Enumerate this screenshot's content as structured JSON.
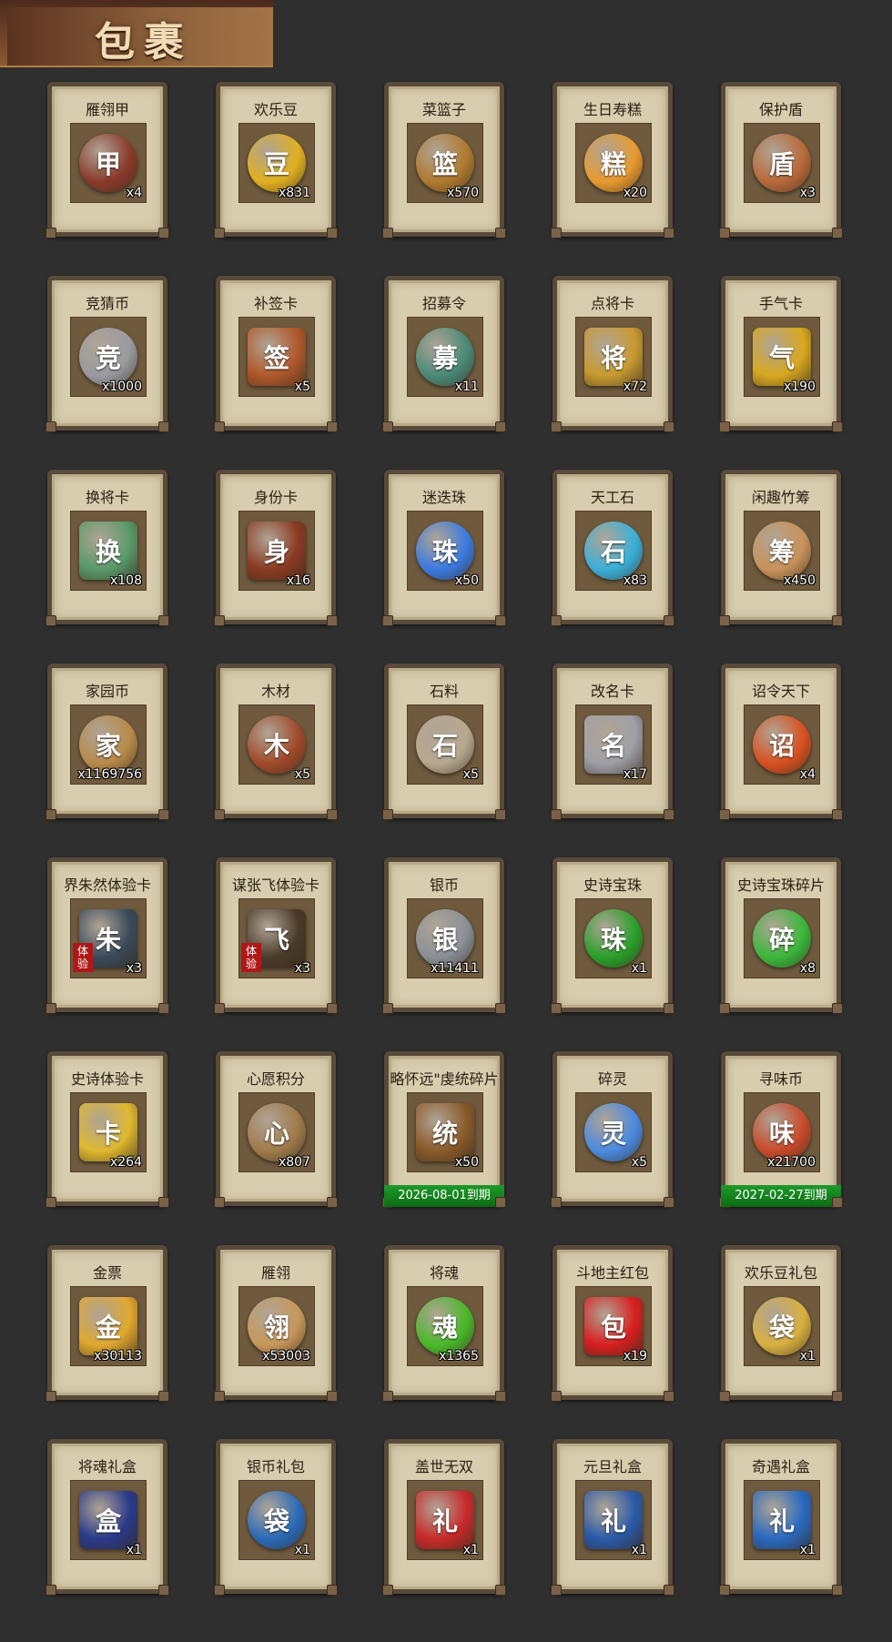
{
  "header": {
    "title": "包裹"
  },
  "items": [
    {
      "name": "雁翎甲",
      "count": "x4",
      "icon": "armor-icon",
      "color": "#8a3a2a",
      "glyph": "甲"
    },
    {
      "name": "欢乐豆",
      "count": "x831",
      "icon": "gold-beans-icon",
      "color": "#e0b020",
      "glyph": "豆"
    },
    {
      "name": "菜篮子",
      "count": "x570",
      "icon": "basket-icon",
      "color": "#b07a30",
      "glyph": "篮"
    },
    {
      "name": "生日寿糕",
      "count": "x20",
      "icon": "cake-icon",
      "color": "#e89a30",
      "glyph": "糕"
    },
    {
      "name": "保护盾",
      "count": "x3",
      "icon": "shield-icon",
      "color": "#b86a3a",
      "glyph": "盾"
    },
    {
      "name": "竞猜币",
      "count": "x1000",
      "icon": "silver-coin-icon",
      "color": "#9a9aa0",
      "glyph": "竞"
    },
    {
      "name": "补签卡",
      "count": "x5",
      "icon": "sign-card-icon",
      "color": "#b0582a",
      "glyph": "签"
    },
    {
      "name": "招募令",
      "count": "x11",
      "icon": "recruit-token-icon",
      "color": "#4a8a78",
      "glyph": "募"
    },
    {
      "name": "点将卡",
      "count": "x72",
      "icon": "general-card-icon",
      "color": "#c89a30",
      "glyph": "将"
    },
    {
      "name": "手气卡",
      "count": "x190",
      "icon": "luck-card-icon",
      "color": "#d8a820",
      "glyph": "气"
    },
    {
      "name": "换将卡",
      "count": "x108",
      "icon": "swap-card-icon",
      "color": "#5a9a6a",
      "glyph": "换"
    },
    {
      "name": "身份卡",
      "count": "x16",
      "icon": "identity-card-icon",
      "color": "#8a3a22",
      "glyph": "身"
    },
    {
      "name": "迷迭珠",
      "count": "x50",
      "icon": "blue-orb-icon",
      "color": "#3a7ae0",
      "glyph": "珠"
    },
    {
      "name": "天工石",
      "count": "x83",
      "icon": "crystal-icon",
      "color": "#3ab0d8",
      "glyph": "石"
    },
    {
      "name": "闲趣竹筹",
      "count": "x450",
      "icon": "bamboo-tally-icon",
      "color": "#c8925a",
      "glyph": "筹"
    },
    {
      "name": "家园币",
      "count": "x1169756",
      "icon": "home-coin-icon",
      "color": "#b88a4a",
      "glyph": "家"
    },
    {
      "name": "木材",
      "count": "x5",
      "icon": "wood-icon",
      "color": "#a04a2a",
      "glyph": "木"
    },
    {
      "name": "石料",
      "count": "x5",
      "icon": "stone-icon",
      "color": "#b8a890",
      "glyph": "石"
    },
    {
      "name": "改名卡",
      "count": "x17",
      "icon": "rename-card-icon",
      "color": "#a0a0a8",
      "glyph": "名"
    },
    {
      "name": "诏令天下",
      "count": "x4",
      "icon": "decree-scroll-icon",
      "color": "#d85020",
      "glyph": "诏"
    },
    {
      "name": "界朱然体验卡",
      "count": "x3",
      "icon": "hero-portrait-icon",
      "color": "#3a4a5a",
      "glyph": "朱",
      "badge": "体验"
    },
    {
      "name": "谋张飞体验卡",
      "count": "x3",
      "icon": "hero-portrait-icon",
      "color": "#4a3a2a",
      "glyph": "飞",
      "badge": "体验"
    },
    {
      "name": "银币",
      "count": "x11411",
      "icon": "silver-coins-icon",
      "color": "#8a9098",
      "glyph": "银"
    },
    {
      "name": "史诗宝珠",
      "count": "x1",
      "icon": "green-orb-icon",
      "color": "#2aa02a",
      "glyph": "珠"
    },
    {
      "name": "史诗宝珠碎片",
      "count": "x8",
      "icon": "green-shard-icon",
      "color": "#3ab83a",
      "glyph": "碎"
    },
    {
      "name": "史诗体验卡",
      "count": "x264",
      "icon": "gold-card-icon",
      "color": "#e0b830",
      "glyph": "卡"
    },
    {
      "name": "心愿积分",
      "count": "x807",
      "icon": "heart-coin-icon",
      "color": "#a07a4a",
      "glyph": "心"
    },
    {
      "name": "略怀远\"虔统碎片",
      "count": "x50",
      "icon": "hero-portrait-icon",
      "color": "#8a5a2a",
      "glyph": "统",
      "expire": "2026-08-01到期"
    },
    {
      "name": "碎灵",
      "count": "x5",
      "icon": "blue-crystal-icon",
      "color": "#4a8ae0",
      "glyph": "灵"
    },
    {
      "name": "寻味币",
      "count": "x21700",
      "icon": "taste-coin-icon",
      "color": "#c84a2a",
      "glyph": "味",
      "expire": "2027-02-27到期"
    },
    {
      "name": "金票",
      "count": "x30113",
      "icon": "gold-ticket-icon",
      "color": "#e0a830",
      "glyph": "金"
    },
    {
      "name": "雁翎",
      "count": "x53003",
      "icon": "feather-icon",
      "color": "#c8985a",
      "glyph": "翎"
    },
    {
      "name": "将魂",
      "count": "x1365",
      "icon": "green-gem-icon",
      "color": "#4ab82a",
      "glyph": "魂"
    },
    {
      "name": "斗地主红包",
      "count": "x19",
      "icon": "red-envelope-icon",
      "color": "#d82020",
      "glyph": "包"
    },
    {
      "name": "欢乐豆礼包",
      "count": "x1",
      "icon": "gold-sack-icon",
      "color": "#d8b040",
      "glyph": "袋"
    },
    {
      "name": "将魂礼盒",
      "count": "x1",
      "icon": "blue-chest-icon",
      "color": "#2a3a8a",
      "glyph": "盒"
    },
    {
      "name": "银币礼包",
      "count": "x1",
      "icon": "blue-sack-icon",
      "color": "#2a6ab8",
      "glyph": "袋"
    },
    {
      "name": "盖世无双",
      "count": "x1",
      "icon": "red-gift-icon",
      "color": "#c82a2a",
      "glyph": "礼"
    },
    {
      "name": "元旦礼盒",
      "count": "x1",
      "icon": "blue-gift-icon",
      "color": "#2a5aa8",
      "glyph": "礼"
    },
    {
      "name": "奇遇礼盒",
      "count": "x1",
      "icon": "blue-gift-icon",
      "color": "#2a6ac0",
      "glyph": "礼"
    }
  ]
}
